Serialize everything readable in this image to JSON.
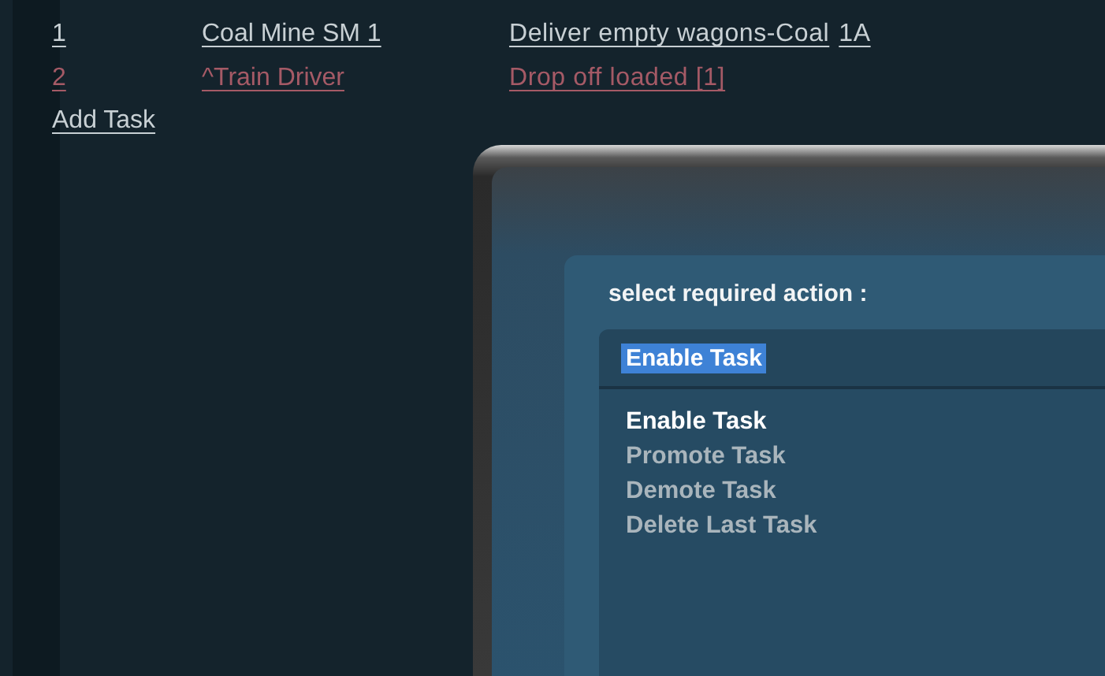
{
  "tasks": [
    {
      "number": "1",
      "name": "Coal Mine SM 1",
      "action": "Deliver empty wagons-Coal",
      "extra": "1A",
      "enabled": true
    },
    {
      "number": "2",
      "name": "^Train Driver",
      "action": "Drop off loaded [1]",
      "enabled": false
    }
  ],
  "add_task": "Add Task",
  "dialog": {
    "label": "select required action :",
    "dropdown": {
      "value": "Enable Task"
    },
    "options": [
      {
        "label": "Enable Task",
        "selected": true
      },
      {
        "label": "Promote Task",
        "selected": false
      },
      {
        "label": "Demote Task",
        "selected": false
      },
      {
        "label": "Delete Last Task",
        "selected": false
      }
    ]
  }
}
